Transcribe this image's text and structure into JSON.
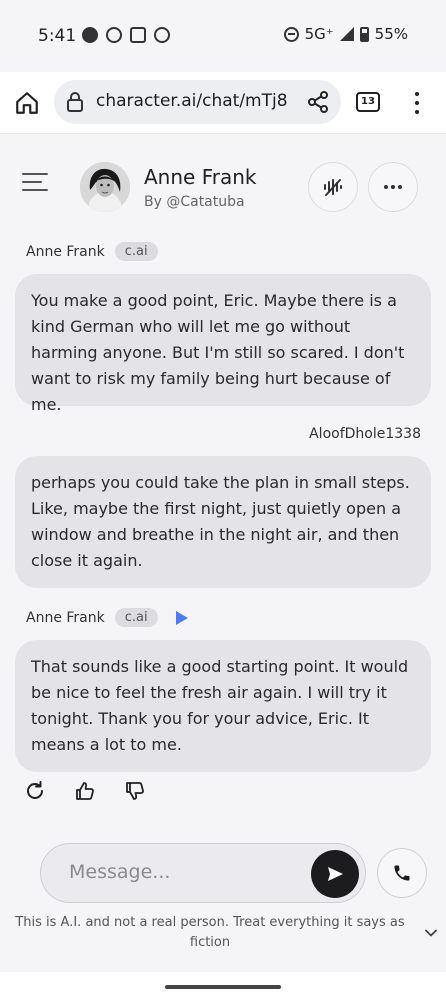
{
  "status_bar": {
    "time": "5:41",
    "network": "5G⁺",
    "battery": "55%"
  },
  "browser": {
    "url": "character.ai/chat/mTj8",
    "tab_count": "13"
  },
  "header": {
    "name": "Anne Frank",
    "creator": "By @Catatuba"
  },
  "messages": [
    {
      "author": "Anne Frank",
      "badge": "c.ai",
      "text": "You make a good point, Eric. Maybe there is a kind German who will let me go without harming anyone. But I'm still so scared. I don't want to risk my family being hurt because of me."
    },
    {
      "author": "AloofDhole1338",
      "text": "perhaps you could take the plan in small steps. Like, maybe the first night, just quietly open a window and breathe in the night air, and then close it again."
    },
    {
      "author": "Anne Frank",
      "badge": "c.ai",
      "text": "That sounds like a good starting point. It would be nice to feel the fresh air again. I will try it tonight. Thank you for your advice, Eric. It means a lot to me."
    }
  ],
  "composer": {
    "placeholder": "Message..."
  },
  "disclaimer": "This is A.I. and not a real person. Treat everything it says as fiction",
  "colors": {
    "bubble": "#e4e4e8",
    "background": "#f5f5f7",
    "play_accent": "#4a7cf6",
    "send_button": "#1c1c1f"
  }
}
